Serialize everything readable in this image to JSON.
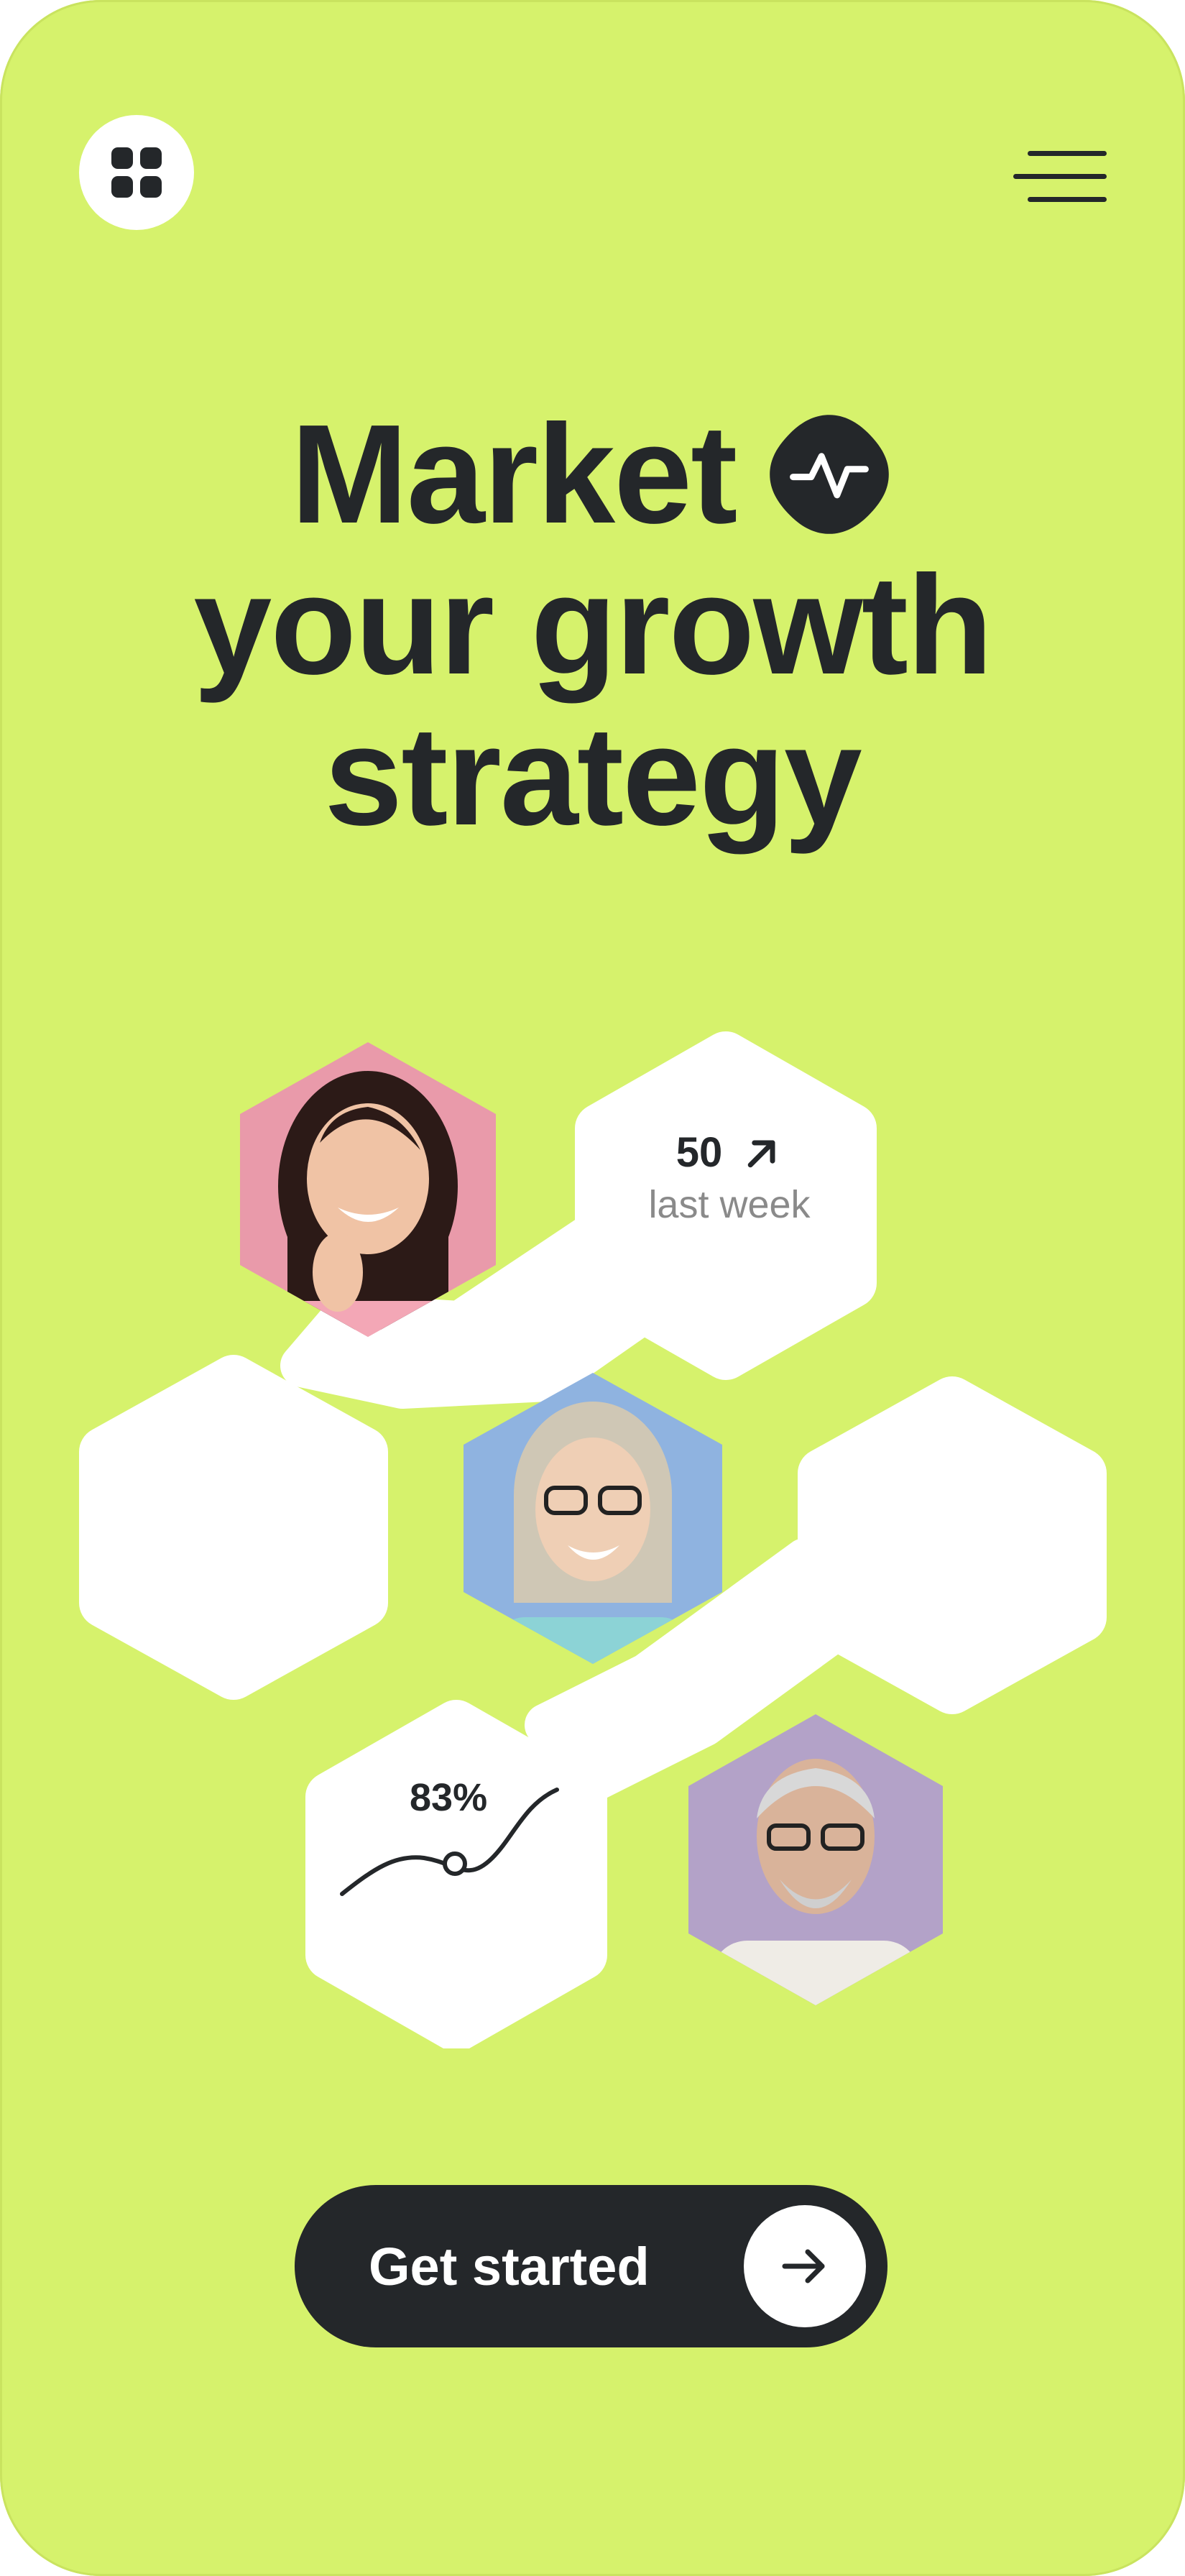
{
  "theme": {
    "background": "#d6f26c",
    "dark": "#24272a",
    "white": "#ffffff"
  },
  "header": {
    "left_icon": "grid-icon",
    "right_icon": "hamburger-menu-icon"
  },
  "hero": {
    "line1": "Market",
    "line2": "your growth",
    "line3": "strategy",
    "badge_icon": "activity-pulse-icon"
  },
  "stats": {
    "weekly": {
      "value": "50",
      "label": "last week",
      "icon": "arrow-up-right-icon"
    },
    "rate": {
      "value": "83%",
      "icon": "trend-line-icon"
    }
  },
  "people": [
    {
      "name": "avatar-woman-pink-background",
      "background": "#e99aaa"
    },
    {
      "name": "avatar-woman-blue-background",
      "background": "#8fb3e0"
    },
    {
      "name": "avatar-man-purple-background",
      "background": "#b3a2c8"
    }
  ],
  "cta": {
    "label": "Get started",
    "icon": "arrow-right-icon"
  }
}
